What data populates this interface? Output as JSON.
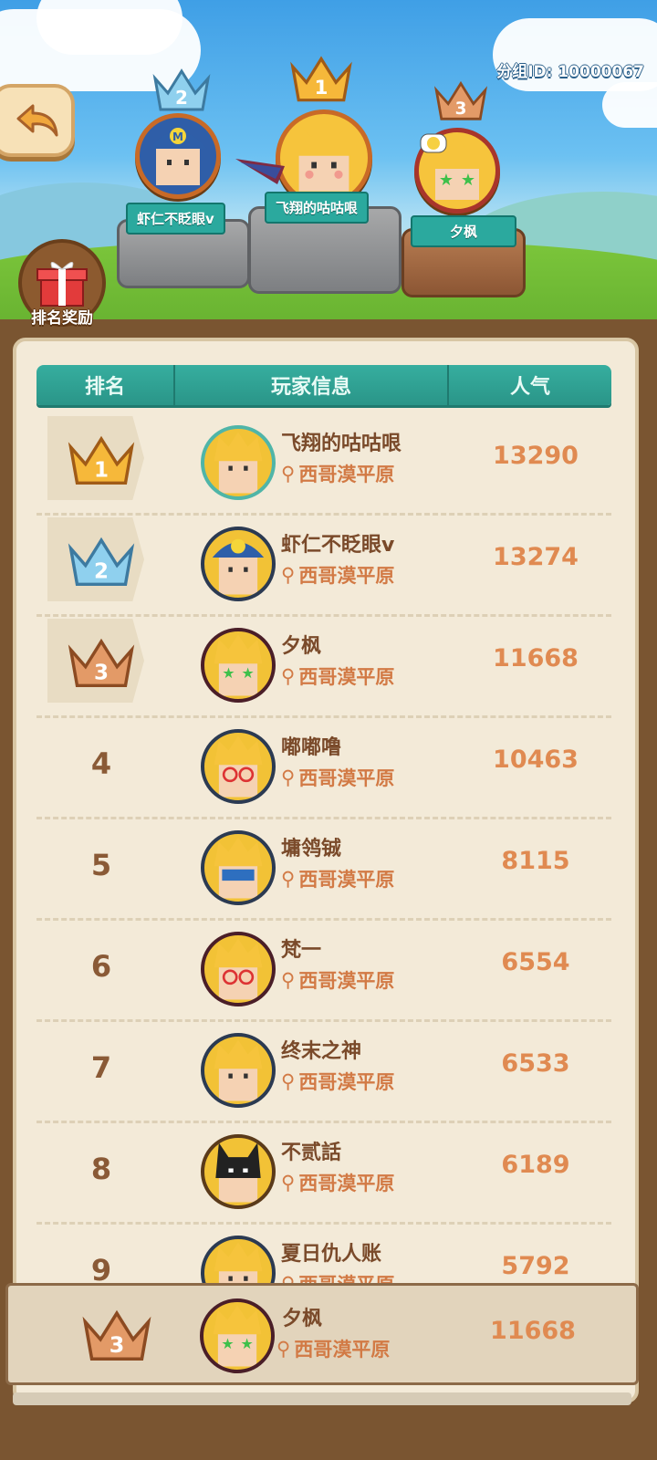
{
  "header": {
    "group_id": "分组ID: 10000067"
  },
  "reward_button": {
    "label": "排名奖励"
  },
  "podium": [
    {
      "place": 2,
      "name": "虾仁不眨眼v",
      "crown": "silver-crown-icon",
      "avatar": "blue-cap-hero-avatar"
    },
    {
      "place": 1,
      "name": "飞翔的咕咕哏",
      "crown": "gold-crown-icon",
      "avatar": "caped-hero-avatar"
    },
    {
      "place": 3,
      "name": "夕枫",
      "crown": "bronze-crown-icon",
      "avatar": "green-glasses-hero-avatar"
    }
  ],
  "table": {
    "headers": {
      "rank": "排名",
      "info": "玩家信息",
      "popularity": "人气"
    },
    "rows": [
      {
        "rank": "1",
        "name": "飞翔的咕咕哏",
        "location": "西哥漠平原",
        "popularity": "13290"
      },
      {
        "rank": "2",
        "name": "虾仁不眨眼v",
        "location": "西哥漠平原",
        "popularity": "13274"
      },
      {
        "rank": "3",
        "name": "夕枫",
        "location": "西哥漠平原",
        "popularity": "11668"
      },
      {
        "rank": "4",
        "name": "嘟嘟噜",
        "location": "西哥漠平原",
        "popularity": "10463"
      },
      {
        "rank": "5",
        "name": "墉鸰铖",
        "location": "西哥漠平原",
        "popularity": "8115"
      },
      {
        "rank": "6",
        "name": "梵一",
        "location": "西哥漠平原",
        "popularity": "6554"
      },
      {
        "rank": "7",
        "name": "终末之神",
        "location": "西哥漠平原",
        "popularity": "6533"
      },
      {
        "rank": "8",
        "name": "不贰話",
        "location": "西哥漠平原",
        "popularity": "6189"
      },
      {
        "rank": "9",
        "name": "夏日仇人账",
        "location": "西哥漠平原",
        "popularity": "5792"
      }
    ]
  },
  "my_rank": {
    "rank": "3",
    "name": "夕枫",
    "location": "西哥漠平原",
    "popularity": "11668"
  },
  "colors": {
    "gold": "#f6b83a",
    "silver": "#8fd0ee",
    "bronze": "#e39a67",
    "teal": "#2ba99e",
    "number": "#e08a51"
  }
}
